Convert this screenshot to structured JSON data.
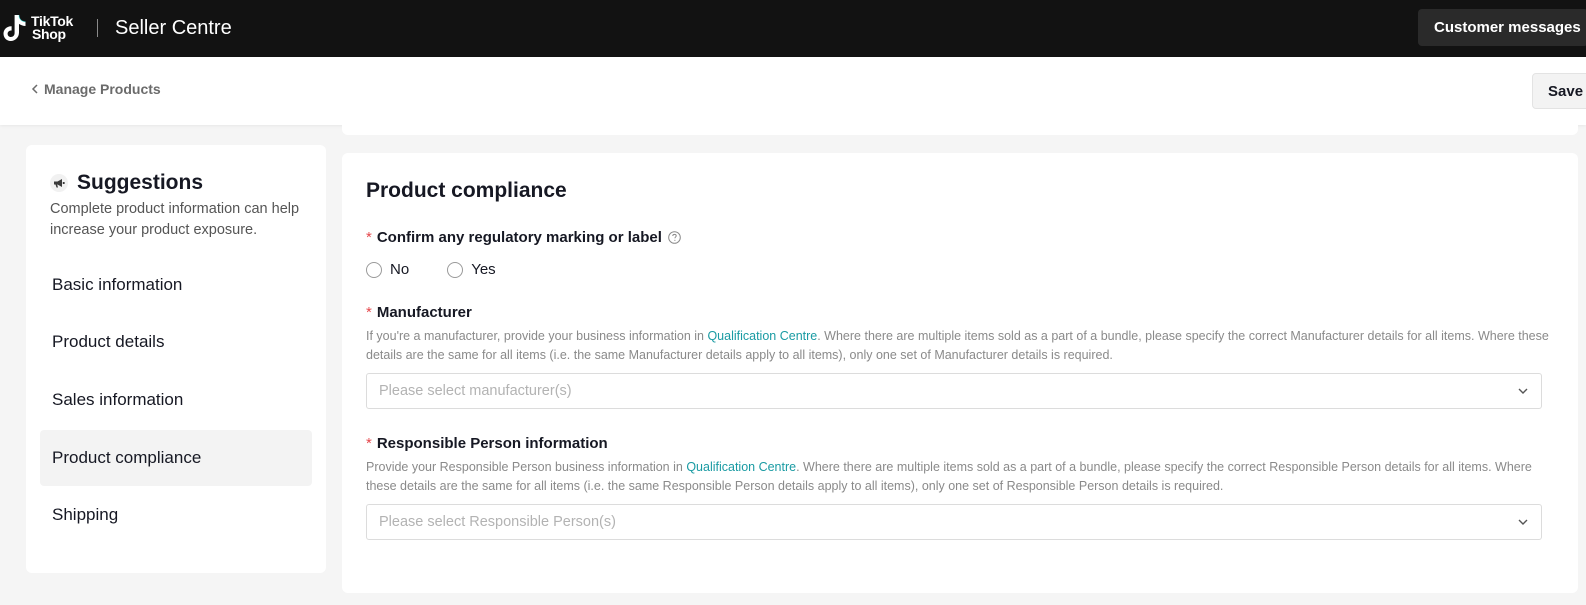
{
  "topbar": {
    "logo_line1": "TikTok",
    "logo_line2": "Shop",
    "app_title": "Seller Centre",
    "customer_messages": "Customer messages"
  },
  "subheader": {
    "back_label": "Manage Products",
    "save_label": "Save"
  },
  "suggestions": {
    "title": "Suggestions",
    "description": "Complete product information can help increase your product exposure.",
    "items": [
      {
        "label": "Basic information"
      },
      {
        "label": "Product details"
      },
      {
        "label": "Sales information"
      },
      {
        "label": "Product compliance"
      },
      {
        "label": "Shipping"
      }
    ],
    "active_index": 3
  },
  "compliance": {
    "title": "Product compliance",
    "regulatory": {
      "required_mark": "*",
      "label": "Confirm any regulatory marking or label",
      "options": [
        "No",
        "Yes"
      ]
    },
    "manufacturer": {
      "required_mark": "*",
      "label": "Manufacturer",
      "helper_prefix": "If you're a manufacturer, provide your business information in ",
      "helper_link": "Qualification Centre",
      "helper_suffix": ". Where there are multiple items sold as a part of a bundle, please specify the correct Manufacturer details for all items. Where these details are the same for all items (i.e. the same Manufacturer details apply to all items), only one set of Manufacturer details is required.",
      "placeholder": "Please select manufacturer(s)"
    },
    "responsible_person": {
      "required_mark": "*",
      "label": "Responsible Person information",
      "helper_prefix": "Provide your Responsible Person business information in ",
      "helper_link": "Qualification Centre",
      "helper_suffix": ". Where there are multiple items sold as a part of a bundle, please specify the correct Responsible Person details for all items. Where these details are the same for all items (i.e. the same Responsible Person details apply to all items), only one set of Responsible Person details is required.",
      "placeholder": "Please select Responsible Person(s)"
    }
  },
  "colors": {
    "topbar_bg": "#121212",
    "link": "#1a9ba3",
    "required": "#e5484d",
    "page_bg": "#f5f5f5"
  }
}
